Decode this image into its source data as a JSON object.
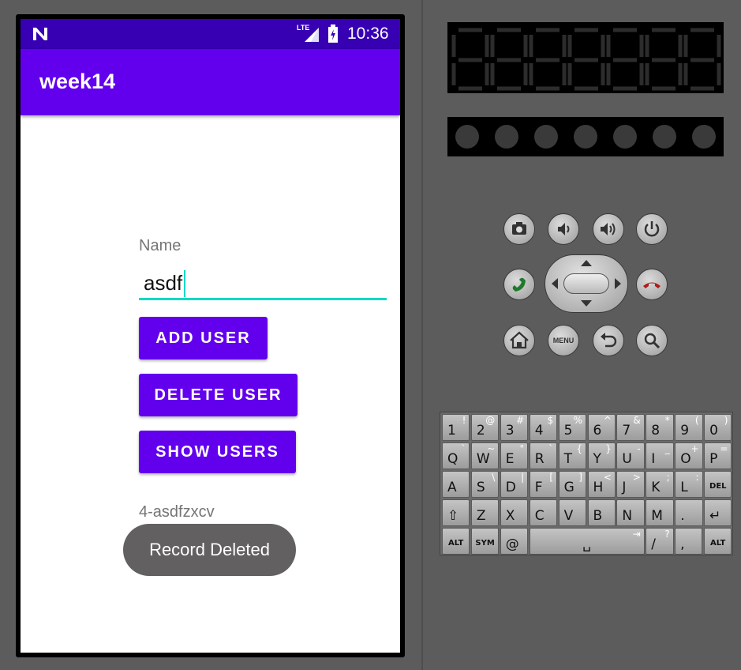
{
  "status_bar": {
    "time": "10:36",
    "network": "LTE"
  },
  "app_bar": {
    "title": "week14"
  },
  "form": {
    "name_label": "Name",
    "name_value": "asdf",
    "add_button": "ADD USER",
    "delete_button": "DELETE USER",
    "show_button": "SHOW USERS",
    "record_text": "4-asdfzxcv"
  },
  "toast": {
    "message": "Record Deleted"
  },
  "colors": {
    "primary": "#6200ee",
    "primary_dark": "#3700b3",
    "accent": "#03dac5",
    "toast": "#636062"
  },
  "emulator": {
    "buttons": [
      "camera-icon",
      "volume-down-icon",
      "volume-up-icon",
      "power-icon",
      "call-icon",
      "end-call-icon",
      "home-icon",
      "menu-button",
      "back-icon",
      "search-icon"
    ],
    "menu_label": "MENU",
    "keyboard_rows": [
      [
        [
          "1",
          "!"
        ],
        [
          "2",
          "@"
        ],
        [
          "3",
          "#"
        ],
        [
          "4",
          "$"
        ],
        [
          "5",
          "%"
        ],
        [
          "6",
          "^"
        ],
        [
          "7",
          "&"
        ],
        [
          "8",
          "*"
        ],
        [
          "9",
          "("
        ],
        [
          "0",
          ")"
        ]
      ],
      [
        [
          "Q",
          "`"
        ],
        [
          "W",
          "~"
        ],
        [
          "E",
          "\""
        ],
        [
          "R",
          "`"
        ],
        [
          "T",
          "{"
        ],
        [
          "Y",
          "}"
        ],
        [
          "U",
          "-"
        ],
        [
          "I",
          "_"
        ],
        [
          "O",
          "+"
        ],
        [
          "P",
          "="
        ]
      ],
      [
        [
          "A",
          ""
        ],
        [
          "S",
          "\\"
        ],
        [
          "D",
          "|"
        ],
        [
          "F",
          "["
        ],
        [
          "G",
          "]"
        ],
        [
          "H",
          "<"
        ],
        [
          "J",
          ">"
        ],
        [
          "K",
          ";"
        ],
        [
          "L",
          ":"
        ],
        [
          "DEL",
          ""
        ]
      ],
      [
        [
          "⇧",
          ""
        ],
        [
          "Z",
          ""
        ],
        [
          "X",
          ""
        ],
        [
          "C",
          ""
        ],
        [
          "V",
          ""
        ],
        [
          "B",
          ""
        ],
        [
          "N",
          ""
        ],
        [
          "M",
          ""
        ],
        [
          ".",
          ""
        ],
        [
          "↵",
          ""
        ]
      ],
      [
        [
          "ALT",
          ""
        ],
        [
          "SYM",
          ""
        ],
        [
          "@",
          ""
        ],
        [
          "␣",
          "⇥"
        ],
        [
          "/",
          "?"
        ],
        [
          ",",
          ""
        ],
        [
          "ALT",
          ""
        ]
      ]
    ]
  }
}
